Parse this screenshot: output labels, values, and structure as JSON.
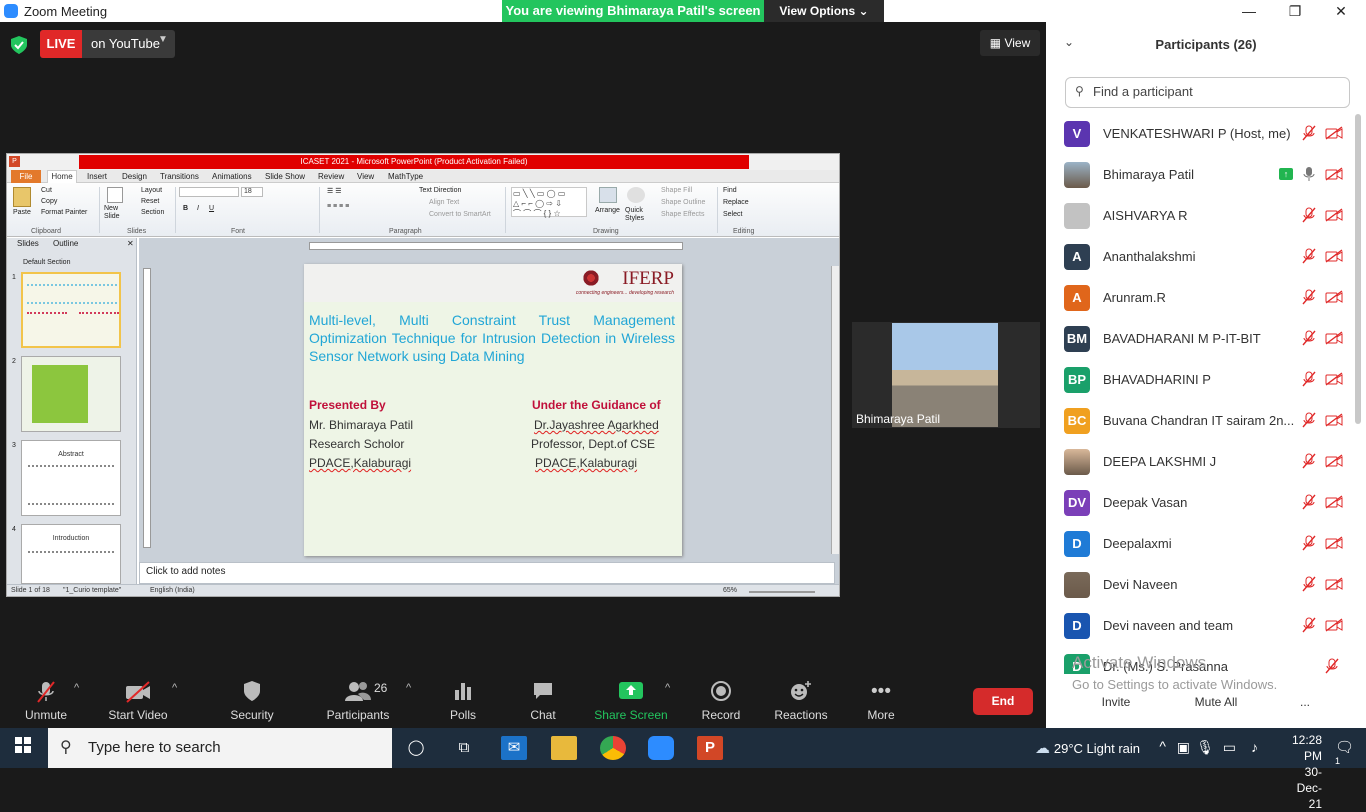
{
  "window": {
    "app_title": "Zoom Meeting",
    "minimize": "—",
    "restore": "❐",
    "close": "✕"
  },
  "banner": {
    "viewing_text": "You are viewing Bhimaraya Patil's screen",
    "view_options": "View Options"
  },
  "meeting": {
    "live_tag": "LIVE",
    "live_target": "on YouTube",
    "view_label": "View"
  },
  "ppt": {
    "window_title": "ICASET 2021 - Microsoft PowerPoint (Product Activation Failed)",
    "file_tab": "File",
    "tabs": [
      "Home",
      "Insert",
      "Design",
      "Transitions",
      "Animations",
      "Slide Show",
      "Review",
      "View",
      "MathType"
    ],
    "ribbon": {
      "paste": "Paste",
      "cut": "Cut",
      "copy": "Copy",
      "format_painter": "Format Painter",
      "new_slide": "New Slide",
      "layout": "Layout",
      "reset": "Reset",
      "section": "Section",
      "font_size": "18",
      "text_direction": "Text Direction",
      "align_text": "Align Text",
      "convert_smartart": "Convert to SmartArt",
      "arrange": "Arrange",
      "quick_styles": "Quick Styles",
      "shape_fill": "Shape Fill",
      "shape_outline": "Shape Outline",
      "shape_effects": "Shape Effects",
      "find": "Find",
      "replace": "Replace",
      "select": "Select",
      "groups": [
        "Clipboard",
        "Slides",
        "Font",
        "Paragraph",
        "Drawing",
        "Editing"
      ]
    },
    "pane_tabs": [
      "Slides",
      "Outline"
    ],
    "section_name": "Default Section",
    "thumbnails": [
      {
        "num": "1"
      },
      {
        "num": "2"
      },
      {
        "num": "3",
        "heading": "Abstract"
      },
      {
        "num": "4",
        "heading": "Introduction"
      }
    ],
    "slide": {
      "logo": "IFERP",
      "logo_tagline": "connecting engineers... developing research",
      "title": "Multi-level, Multi Constraint Trust Management Optimization Technique for Intrusion Detection in Wireless Sensor Network using Data Mining",
      "left_head": "Presented By",
      "left_lines": [
        "Mr. Bhimaraya Patil",
        "Research Scholor",
        "PDACE,Kalaburagi"
      ],
      "right_head": "Under the Guidance of",
      "right_lines": [
        "Dr.Jayashree Agarkhed",
        "Professor, Dept.of CSE",
        "PDACE,Kalaburagi"
      ]
    },
    "notes_placeholder": "Click to add notes",
    "status": {
      "slide_of": "Slide 1 of 18",
      "theme": "\"1_Curio template\"",
      "language": "English (India)",
      "zoom": "65%"
    }
  },
  "video_tile": {
    "name": "Bhimaraya Patil"
  },
  "toolbar": {
    "unmute": "Unmute",
    "start_video": "Start Video",
    "security": "Security",
    "participants": "Participants",
    "participants_count": "26",
    "polls": "Polls",
    "chat": "Chat",
    "share_screen": "Share Screen",
    "record": "Record",
    "reactions": "Reactions",
    "more": "More",
    "end": "End"
  },
  "panel": {
    "title": "Participants (26)",
    "search_placeholder": "Find a participant",
    "participants": [
      {
        "name": "VENKATESHWARI P (Host, me)",
        "initial": "V",
        "color": "#5b35b0",
        "photo": false
      },
      {
        "name": "Bhimaraya Patil",
        "initial": "",
        "color": "#9bb3c7",
        "photo": true,
        "sharing": true
      },
      {
        "name": "AISHVARYA R",
        "initial": "",
        "color": "#c2c2c2",
        "photo": false
      },
      {
        "name": "Ananthalakshmi",
        "initial": "A",
        "color": "#2e3f52",
        "photo": false
      },
      {
        "name": "Arunram.R",
        "initial": "A",
        "color": "#e0661b",
        "photo": false
      },
      {
        "name": "BAVADHARANI M P-IT-BIT",
        "initial": "BM",
        "color": "#2e3f52",
        "photo": false
      },
      {
        "name": "BHAVADHARINI P",
        "initial": "BP",
        "color": "#1aa06a",
        "photo": false
      },
      {
        "name": "Buvana  Chandran IT sairam 2n...",
        "initial": "BC",
        "color": "#f0a020",
        "photo": false
      },
      {
        "name": "DEEPA LAKSHMI J",
        "initial": "",
        "color": "#d9b89a",
        "photo": true
      },
      {
        "name": "Deepak Vasan",
        "initial": "DV",
        "color": "#7b3fb8",
        "photo": false
      },
      {
        "name": "Deepalaxmi",
        "initial": "D",
        "color": "#1f7bd6",
        "photo": false
      },
      {
        "name": "Devi Naveen",
        "initial": "",
        "color": "#7a6a5a",
        "photo": true
      },
      {
        "name": "Devi naveen and team",
        "initial": "D",
        "color": "#1955b0",
        "photo": false
      },
      {
        "name": "Dr. (Ms.) S. Prasanna",
        "initial": "D",
        "color": "#1aa06a",
        "photo": false
      }
    ],
    "watermark_title": "Activate Windows",
    "watermark_sub": "Go to Settings to activate Windows.",
    "invite": "Invite",
    "mute_all": "Mute All",
    "more": "..."
  },
  "taskbar": {
    "search_placeholder": "Type here to search",
    "weather": "29°C  Light rain",
    "time": "12:28 PM",
    "date": "30-Dec-21",
    "notifications": "1"
  }
}
